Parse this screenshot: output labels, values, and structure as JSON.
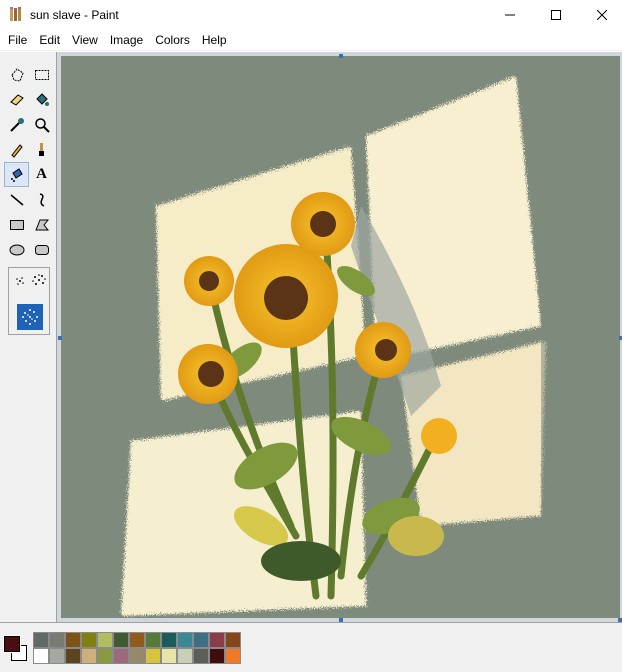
{
  "window": {
    "title": "sun slave - Paint",
    "minimize_glyph": "─",
    "maximize_glyph": "☐",
    "close_glyph": "✕"
  },
  "menu": [
    "File",
    "Edit",
    "View",
    "Image",
    "Colors",
    "Help"
  ],
  "tools": [
    {
      "name": "free-form-select-icon"
    },
    {
      "name": "rect-select-icon"
    },
    {
      "name": "eraser-icon"
    },
    {
      "name": "fill-bucket-icon"
    },
    {
      "name": "color-picker-icon"
    },
    {
      "name": "magnifier-icon"
    },
    {
      "name": "pencil-icon"
    },
    {
      "name": "brush-icon"
    },
    {
      "name": "airbrush-icon",
      "selected": true
    },
    {
      "name": "text-icon",
      "glyph": "A"
    },
    {
      "name": "line-icon"
    },
    {
      "name": "curve-icon"
    },
    {
      "name": "rectangle-icon"
    },
    {
      "name": "polygon-icon"
    },
    {
      "name": "ellipse-icon"
    },
    {
      "name": "rounded-rect-icon"
    }
  ],
  "colors": {
    "foreground": "#4a0e12",
    "background": "#ffffff",
    "palette_top": [
      "#5f6b62",
      "#7a7a72",
      "#7d5418",
      "#808011",
      "#b0bd62",
      "#3e5b34",
      "#8f5b1f",
      "#557a3a",
      "#1a5c5a",
      "#3b8796",
      "#3e7085",
      "#8a3c48",
      "#85471a",
      ""
    ],
    "palette_bottom": [
      "#ffffff",
      "#a2a9a0",
      "#5d4421",
      "#cdb07c",
      "#8b9a42",
      "#9b6a7f",
      "#96896a",
      "#d6c53c",
      "#e8e3a8",
      "#c9cfb6",
      "#5a5f5a",
      "#410c0e",
      "#f07a2a",
      ""
    ]
  },
  "canvas": {
    "image_description": "sunflowers in sunlight"
  }
}
